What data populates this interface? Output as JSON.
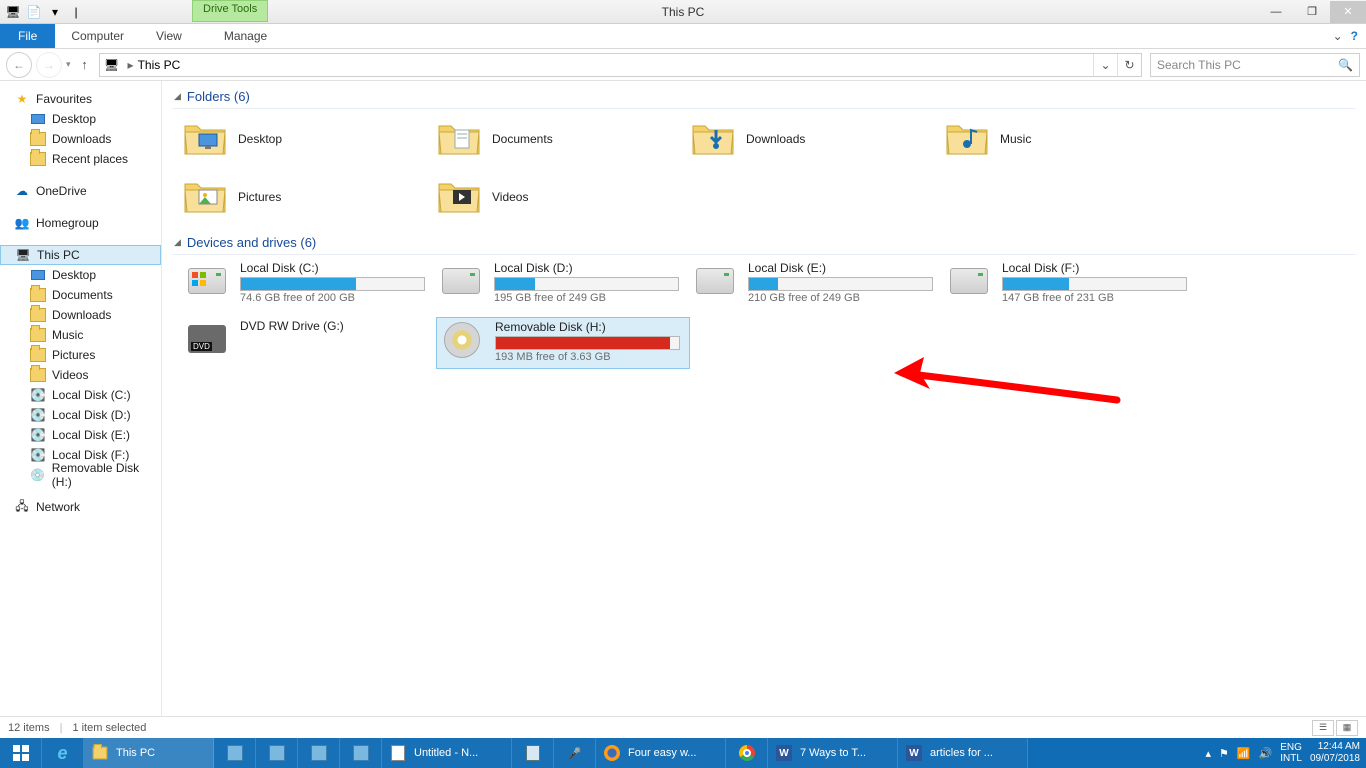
{
  "window": {
    "title": "This PC",
    "drive_tools_label": "Drive Tools"
  },
  "ribbon": {
    "file": "File",
    "tabs": [
      "Computer",
      "View",
      "Manage"
    ]
  },
  "nav": {
    "breadcrumb_root_icon": "pc-icon",
    "breadcrumb": "This PC",
    "search_placeholder": "Search This PC"
  },
  "sidebar": {
    "favourites_label": "Favourites",
    "favourites": [
      "Desktop",
      "Downloads",
      "Recent places"
    ],
    "onedrive": "OneDrive",
    "homegroup": "Homegroup",
    "thispc_label": "This PC",
    "thispc_items": [
      "Desktop",
      "Documents",
      "Downloads",
      "Music",
      "Pictures",
      "Videos",
      "Local Disk (C:)",
      "Local Disk (D:)",
      "Local Disk (E:)",
      "Local Disk (F:)",
      "Removable Disk (H:)"
    ],
    "network": "Network"
  },
  "content": {
    "folders_header": "Folders (6)",
    "folders": [
      "Desktop",
      "Documents",
      "Downloads",
      "Music",
      "Pictures",
      "Videos"
    ],
    "drives_header": "Devices and drives (6)",
    "drives": [
      {
        "name": "Local Disk (C:)",
        "free_text": "74.6 GB free of 200 GB",
        "fill_pct": 63,
        "color": "blue",
        "kind": "os"
      },
      {
        "name": "Local Disk (D:)",
        "free_text": "195 GB free of 249 GB",
        "fill_pct": 22,
        "color": "blue",
        "kind": "hdd"
      },
      {
        "name": "Local Disk (E:)",
        "free_text": "210 GB free of 249 GB",
        "fill_pct": 16,
        "color": "blue",
        "kind": "hdd"
      },
      {
        "name": "Local Disk (F:)",
        "free_text": "147 GB free of 231 GB",
        "fill_pct": 36,
        "color": "blue",
        "kind": "hdd"
      },
      {
        "name": "DVD RW Drive (G:)",
        "free_text": "",
        "fill_pct": 0,
        "color": "none",
        "kind": "dvd"
      },
      {
        "name": "Removable Disk (H:)",
        "free_text": "193 MB free of 3.63 GB",
        "fill_pct": 95,
        "color": "red",
        "kind": "removable",
        "selected": true
      }
    ]
  },
  "statusbar": {
    "items": "12 items",
    "selected": "1 item selected"
  },
  "taskbar": {
    "items": [
      {
        "icon": "start-icon",
        "label": ""
      },
      {
        "icon": "ie-icon",
        "label": ""
      },
      {
        "icon": "explorer-icon",
        "label": "This PC"
      },
      {
        "icon": "app-icon",
        "label": ""
      },
      {
        "icon": "app-icon",
        "label": ""
      },
      {
        "icon": "app-icon",
        "label": ""
      },
      {
        "icon": "app-icon",
        "label": ""
      },
      {
        "icon": "notepad-icon",
        "label": "Untitled - N..."
      },
      {
        "icon": "calc-icon",
        "label": ""
      },
      {
        "icon": "mic-icon",
        "label": ""
      },
      {
        "icon": "firefox-icon",
        "label": "Four easy w..."
      },
      {
        "icon": "chrome-icon",
        "label": ""
      },
      {
        "icon": "word-icon",
        "label": "7 Ways to T..."
      },
      {
        "icon": "word-icon",
        "label": "articles for ..."
      }
    ],
    "tray": {
      "lang1": "ENG",
      "lang2": "INTL",
      "time": "12:44 AM",
      "date": "09/07/2018"
    }
  }
}
